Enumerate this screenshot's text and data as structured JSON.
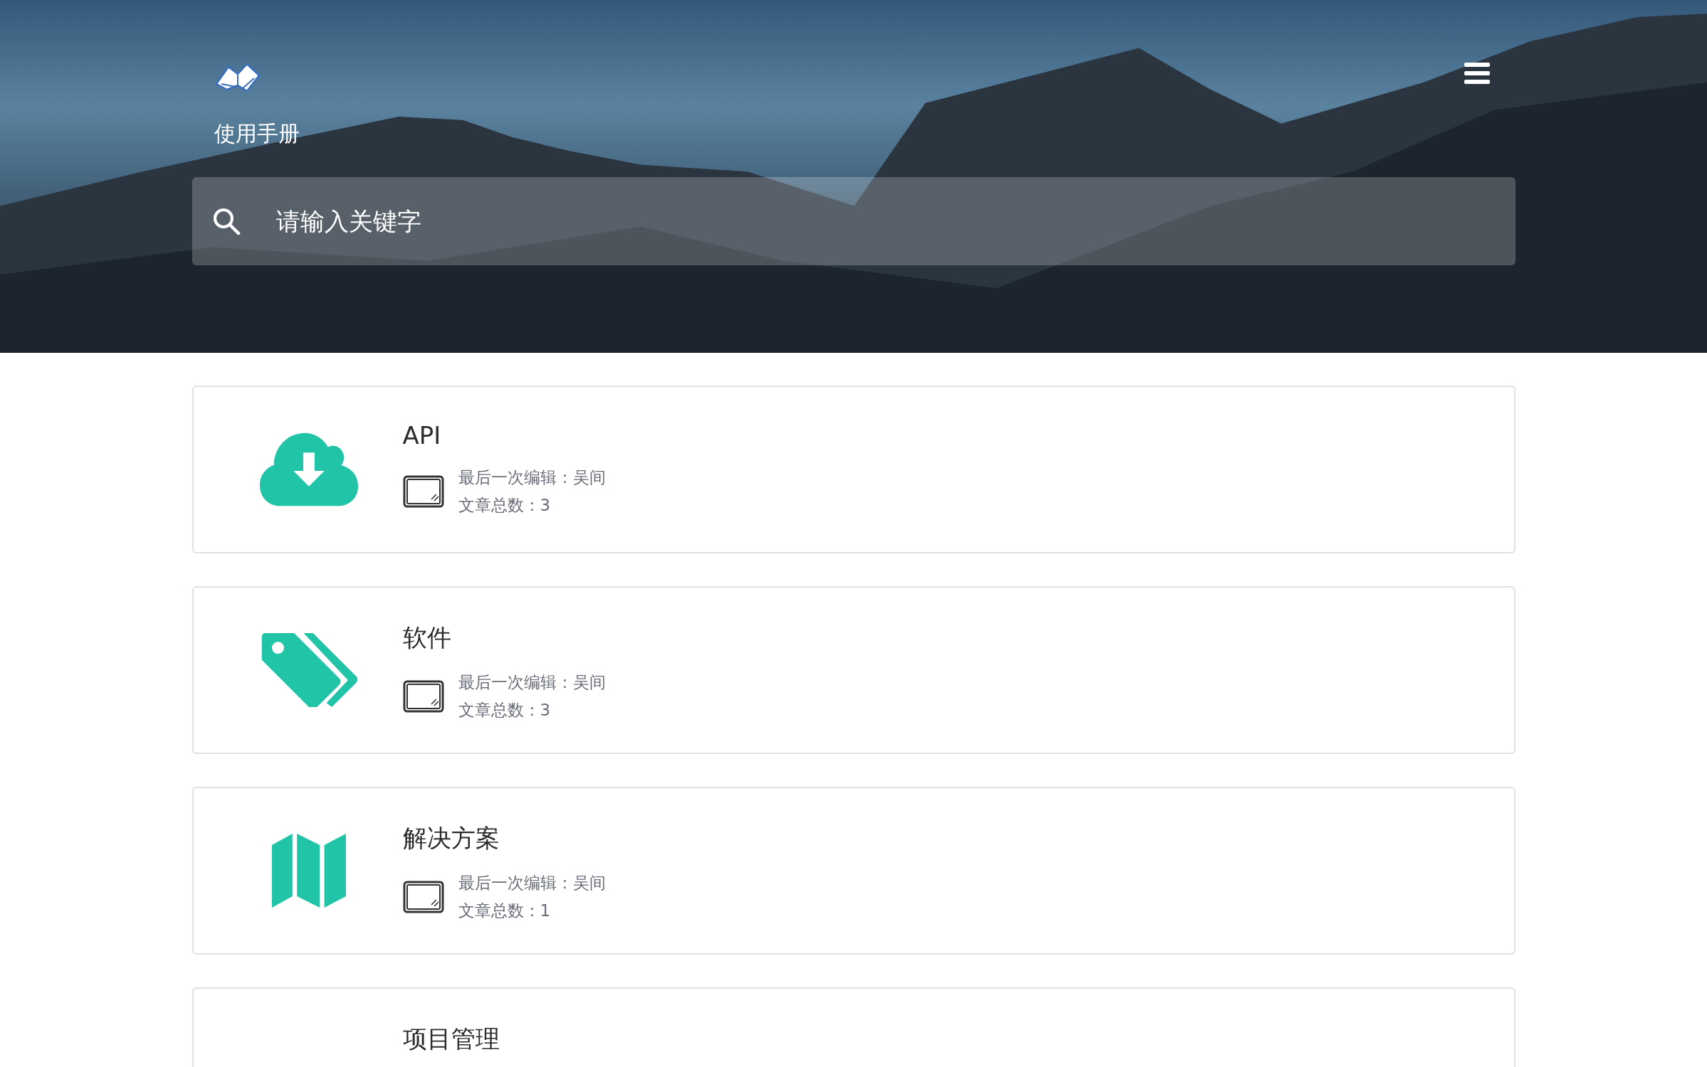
{
  "header": {
    "title": "使用手册",
    "search": {
      "placeholder": "请输入关键字"
    }
  },
  "cards": [
    {
      "kind": "cloud-download",
      "title": "API",
      "last_edit": "最后一次编辑：吴间",
      "article_count": "文章总数：3"
    },
    {
      "kind": "tags",
      "title": "软件",
      "last_edit": "最后一次编辑：吴间",
      "article_count": "文章总数：3"
    },
    {
      "kind": "map",
      "title": "解决方案",
      "last_edit": "最后一次编辑：吴间",
      "article_count": "文章总数：1"
    },
    {
      "kind": "partial",
      "title": "项目管理"
    }
  ]
}
